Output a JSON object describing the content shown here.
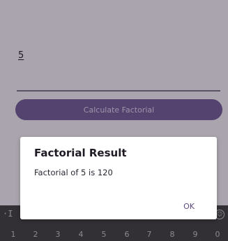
{
  "input": {
    "value": "5"
  },
  "calculate_button": {
    "label": "Calculate Factorial"
  },
  "dialog": {
    "title": "Factorial Result",
    "message": "Factorial of 5 is 120",
    "ok_label": "OK"
  },
  "keyboard": {
    "left_icon": "·I",
    "right_icon_name": "emoji-icon",
    "number_row": [
      "1",
      "2",
      "3",
      "4",
      "5",
      "6",
      "7",
      "8",
      "9",
      "0"
    ]
  },
  "colors": {
    "background": "#a9a4ad",
    "button": "#54426f",
    "dialog_accent": "#5b4a7e",
    "keyboard": "#333035"
  }
}
